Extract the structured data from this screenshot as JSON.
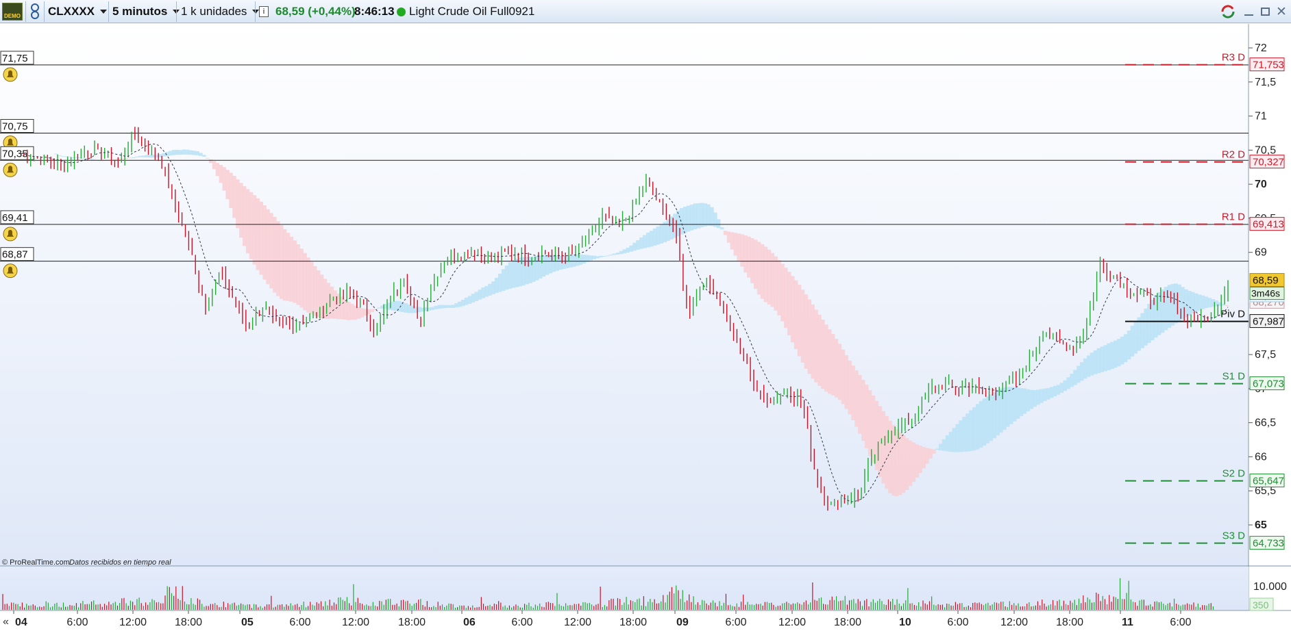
{
  "toolbar": {
    "demo_label": "DEMO",
    "symbol": "CLXXXX",
    "timeframe": "5 minutos",
    "units": "1 k unidades",
    "last_change": "68,59 (+0,44%)",
    "time": "8:46:13",
    "instrument": "Light Crude Oil Full0921",
    "status_color": "#22aa22"
  },
  "chart_data": {
    "type": "line",
    "xlabel": "",
    "ylabel": "",
    "ylim": [
      64.65,
      72.55
    ],
    "x_tick_labels": [
      "04",
      "6:00",
      "12:00",
      "18:00",
      "05",
      "6:00",
      "12:00",
      "18:00",
      "06",
      "6:00",
      "12:00",
      "18:00",
      "09",
      "6:00",
      "12:00",
      "18:00",
      "10",
      "6:00",
      "12:00",
      "18:00",
      "11",
      "6:00"
    ],
    "y_tick_labels": [
      "72",
      "71,5",
      "71",
      "70,5",
      "70",
      "69,5",
      "69",
      "67,5",
      "67",
      "66,5",
      "66",
      "65,5",
      "65"
    ],
    "y_ticks": [
      72,
      71.5,
      71,
      70.5,
      70,
      69.5,
      69,
      67.5,
      67,
      66.5,
      66,
      65.5,
      65
    ],
    "price_series": [
      70.45,
      70.4,
      70.35,
      70.25,
      70.45,
      70.5,
      70.45,
      70.3,
      70.75,
      70.55,
      70.3,
      69.6,
      69.0,
      68.2,
      68.7,
      68.3,
      67.9,
      68.2,
      67.95,
      67.95,
      68.0,
      68.1,
      68.35,
      68.4,
      68.25,
      67.85,
      68.3,
      68.65,
      67.95,
      68.55,
      68.95,
      68.95,
      69.05,
      68.85,
      69.0,
      69.0,
      68.95,
      69.0,
      68.9,
      69.0,
      69.2,
      69.55,
      69.35,
      69.6,
      70.05,
      69.7,
      69.4,
      68.1,
      68.6,
      68.4,
      67.9,
      67.4,
      66.9,
      66.85,
      67.0,
      66.8,
      65.7,
      65.3,
      65.35,
      65.45,
      66.0,
      66.35,
      66.45,
      66.6,
      67.0,
      67.05,
      67.0,
      67.05,
      66.9,
      67.0,
      67.1,
      67.4,
      67.85,
      67.7,
      67.6,
      67.9,
      68.8,
      68.65,
      68.45,
      68.35,
      68.3,
      68.3,
      68.05,
      68.0,
      68.1,
      68.55
    ],
    "series": [
      {
        "name": "Piv D",
        "value": 67.987,
        "label": "67,987"
      },
      {
        "name": "R1 D",
        "value": 69.413,
        "label": "69,413"
      },
      {
        "name": "R2 D",
        "value": 70.327,
        "label": "70,327"
      },
      {
        "name": "R3 D",
        "value": 71.753,
        "label": "71,753"
      },
      {
        "name": "S1 D",
        "value": 67.073,
        "label": "67,073"
      },
      {
        "name": "S2 D",
        "value": 65.647,
        "label": "65,647"
      },
      {
        "name": "S3 D",
        "value": 64.733,
        "label": "64,733"
      }
    ],
    "alert_lines": [
      {
        "value": 71.75,
        "label": "71,75"
      },
      {
        "value": 70.75,
        "label": "70,75"
      },
      {
        "value": 70.35,
        "label": "70,35"
      },
      {
        "value": 69.41,
        "label": "69,41"
      },
      {
        "value": 68.87,
        "label": "68,87"
      }
    ],
    "price_tags": {
      "last": {
        "value": 68.59,
        "label": "68,59"
      },
      "countdown": "3m46s",
      "cloud_a": {
        "value": 68.365,
        "label": "68,365"
      },
      "cloud_b": {
        "value": 68.27,
        "label": "68,270"
      }
    },
    "volume": {
      "axis_label": "10.000",
      "current_label": "350",
      "profile": [
        1,
        1.1,
        1,
        1.2,
        1,
        1.1,
        1.3,
        1.2,
        1.5,
        1.6,
        1.4,
        1.6,
        4.5,
        2.3,
        1.4,
        1.2,
        1,
        0.9,
        0.8,
        0.9,
        1,
        1.2,
        1.1,
        1.6,
        1.8,
        1.8,
        1.4,
        1.5,
        1.7,
        1.6,
        1.2,
        1,
        0.9,
        0.9,
        0.8,
        1,
        1,
        1,
        1.1,
        1,
        1.1,
        1,
        1.3,
        1.6,
        2,
        1.8,
        1.4,
        3.5,
        2.2,
        1.5,
        1.3,
        1.2,
        1.1,
        1,
        1.2,
        1.1,
        1.4,
        1.6,
        1.8,
        2,
        1.7,
        1.5,
        1.6,
        1.5,
        1.4,
        1.3,
        1.2,
        1.1,
        1.1,
        1,
        1.2,
        1.1,
        1.3,
        1.4,
        1.5,
        1.3,
        2.2,
        2.4,
        1.9,
        1.6,
        1.5,
        1.3,
        1.2,
        1.1,
        1,
        0.9
      ]
    },
    "colors": {
      "candle_up": "#22aa33",
      "candle_down": "#cc1122",
      "resistance": "#cc1a2a",
      "support": "#1e8f34",
      "cloud_up": "#b8e2f6",
      "cloud_down": "#f9cfd3",
      "last_price_bg": "#f2c830"
    },
    "copyright": "© ProRealTime.com",
    "data_note": "Datos recibidos en tiempo real"
  }
}
